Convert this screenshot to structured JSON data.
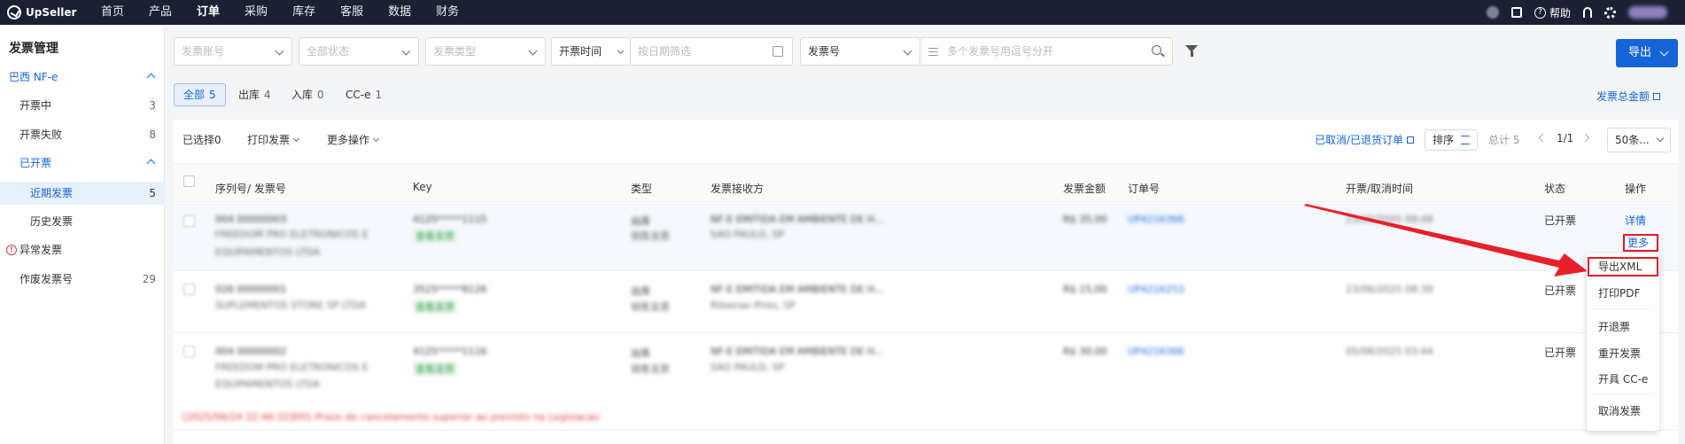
{
  "topnav": {
    "brand": "UpSeller",
    "items": [
      "首页",
      "产品",
      "订单",
      "采购",
      "库存",
      "客服",
      "数据",
      "财务"
    ],
    "active_index": 2,
    "help_label": "帮助"
  },
  "sidebar": {
    "title": "发票管理",
    "group_br": "巴西 NF-e",
    "items": [
      {
        "label": "开票中",
        "count": "3"
      },
      {
        "label": "开票失败",
        "count": "8"
      }
    ],
    "group_issued": "已开票",
    "sub_recent": {
      "label": "近期发票",
      "count": "5"
    },
    "sub_history": {
      "label": "历史发票"
    },
    "abnormal": "异常发票",
    "voided": {
      "label": "作废发票号",
      "count": "29"
    }
  },
  "filters": {
    "account_placeholder": "发票账号",
    "status_placeholder": "全部状态",
    "type_placeholder": "发票类型",
    "time_label": "开票时间",
    "date_placeholder": "按日期筛选",
    "number_select": "发票号",
    "number_placeholder": "多个发票号用逗号分开"
  },
  "export_button": "导出",
  "tabs": [
    {
      "label": "全部",
      "count": "5"
    },
    {
      "label": "出库",
      "count": "4"
    },
    {
      "label": "入库",
      "count": "0"
    },
    {
      "label": "CC-e",
      "count": "1"
    }
  ],
  "total_amount_link": "发票总金额",
  "toolbar": {
    "selected_label": "已选择",
    "selected_count": "0",
    "print_label": "打印发票",
    "more_ops_label": "更多操作",
    "cancelled_link": "已取消/已退货订单",
    "sort_label": "排序",
    "total_label": "总计 5",
    "page_indicator": "1/1",
    "page_size": "50条..."
  },
  "table": {
    "columns": [
      "序列号/ 发票号",
      "Key",
      "类型",
      "发票接收方",
      "发票金额",
      "订单号",
      "开票/取消时间",
      "状态",
      "操作"
    ],
    "rows": [
      {
        "serial": "004 00000003",
        "company": "FREEDOM PRO ELETRONICOS E",
        "company2": "EQUIPAMENTOS LTDA",
        "key": "4125*****1115",
        "key_tag": "查看发票",
        "type": "出库",
        "type2": "销售发票",
        "receiver": "NF-E EMITIDA EM AMBIENTE DE H...",
        "receiver2": "SAO PAULO, SP",
        "amount": "R$ 35,00",
        "order": "UP4216366",
        "time": "23/06/2025 09:48",
        "status": "已开票"
      },
      {
        "serial": "026 00000001",
        "company": "SUPLEMENTOS STORE SP LTDA",
        "company2": "",
        "key": "3525*****8126",
        "key_tag": "查看发票",
        "type": "出库",
        "type2": "销售发票",
        "receiver": "NF-E EMITIDA EM AMBIENTE DE H...",
        "receiver2": "Ribeirao Pires, SP",
        "amount": "R$ 15,00",
        "order": "UP4216253",
        "time": "23/06/2025 08:39",
        "status": "已开票"
      },
      {
        "serial": "004 00000002",
        "company": "FREEDOM PRO ELETRONICOS E",
        "company2": "EQUIPAMENTOS LTDA",
        "key": "4125*****1116",
        "key_tag": "查看发票",
        "type": "出库",
        "type2": "销售发票",
        "receiver": "NF-E EMITIDA EM AMBIENTE DE H...",
        "receiver2": "SAO PAULO, SP",
        "amount": "R$ 30,00",
        "order": "UP4216366",
        "time": "05/06/2025 03:44",
        "status": "已开票"
      }
    ],
    "error_note": "[2025/06/24 22:46:32]001-Prazo de cancelamento superior ao previsto na Legislacao"
  },
  "actions": {
    "detail": "详情",
    "more": "更多"
  },
  "more_menu": [
    "导出XML",
    "打印PDF",
    "开退票",
    "重开发票",
    "开具 CC-e",
    "取消发票"
  ],
  "colors": {
    "accent": "#1565d8",
    "highlight_box": "#e01b24",
    "arrow": "#e8202a",
    "nav_bg": "#1b2133"
  }
}
